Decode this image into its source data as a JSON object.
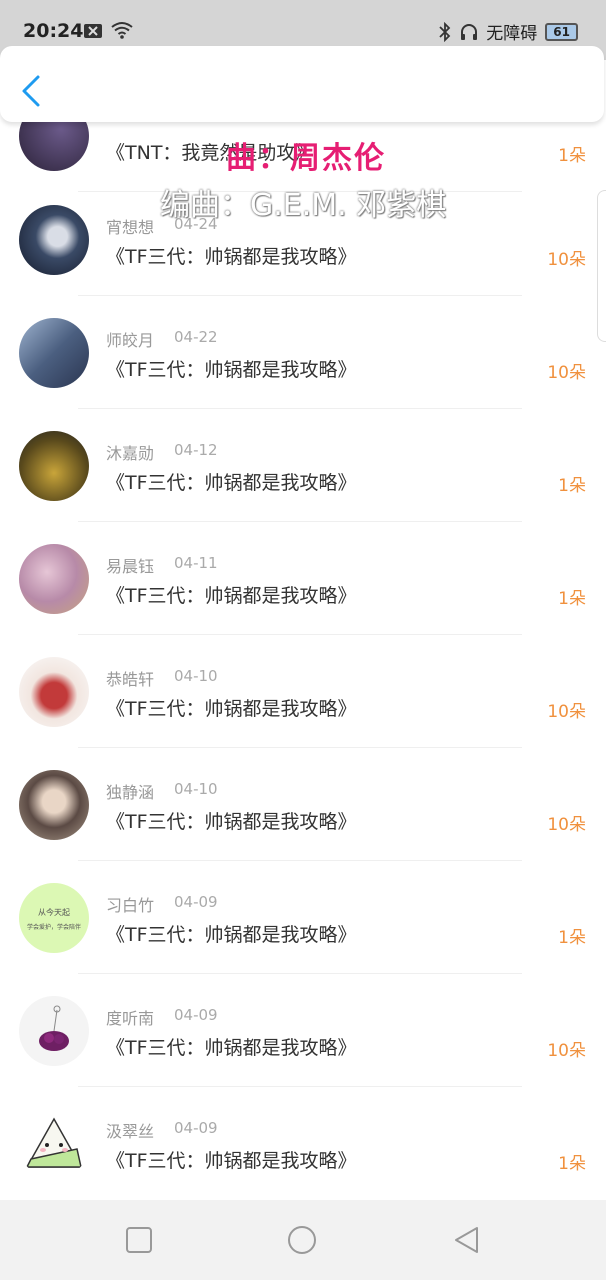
{
  "status_bar": {
    "time": "20:24",
    "accessibility_label": "无障碍",
    "battery": "61"
  },
  "lyrics": {
    "line1": "曲：周杰伦",
    "line2": "编曲：G.E.M. 邓紫棋"
  },
  "list": [
    {
      "name": "",
      "date": "",
      "title": "《TNT：我竟然是助攻》",
      "gift": "1朵"
    },
    {
      "name": "宵想想",
      "date": "04-24",
      "title": "《TF三代：帅锅都是我攻略》",
      "gift": "10朵"
    },
    {
      "name": "师皎月",
      "date": "04-22",
      "title": "《TF三代：帅锅都是我攻略》",
      "gift": "10朵"
    },
    {
      "name": "沐嘉勋",
      "date": "04-12",
      "title": "《TF三代：帅锅都是我攻略》",
      "gift": "1朵"
    },
    {
      "name": "易晨钰",
      "date": "04-11",
      "title": "《TF三代：帅锅都是我攻略》",
      "gift": "1朵"
    },
    {
      "name": "恭皓轩",
      "date": "04-10",
      "title": "《TF三代：帅锅都是我攻略》",
      "gift": "10朵"
    },
    {
      "name": "独静涵",
      "date": "04-10",
      "title": "《TF三代：帅锅都是我攻略》",
      "gift": "10朵"
    },
    {
      "name": "习白竹",
      "date": "04-09",
      "title": "《TF三代：帅锅都是我攻略》",
      "gift": "1朵"
    },
    {
      "name": "度听南",
      "date": "04-09",
      "title": "《TF三代：帅锅都是我攻略》",
      "gift": "10朵"
    },
    {
      "name": "汲翠丝",
      "date": "04-09",
      "title": "《TF三代：帅锅都是我攻略》",
      "gift": "1朵"
    }
  ],
  "avatar_texts": {
    "a8_line1": "从今天起",
    "a8_line2": "学会爱护，学会陪伴"
  },
  "colors": {
    "accent": "#1e9bf0",
    "gift": "#f0913e",
    "lyric_highlight": "#e61e73"
  }
}
